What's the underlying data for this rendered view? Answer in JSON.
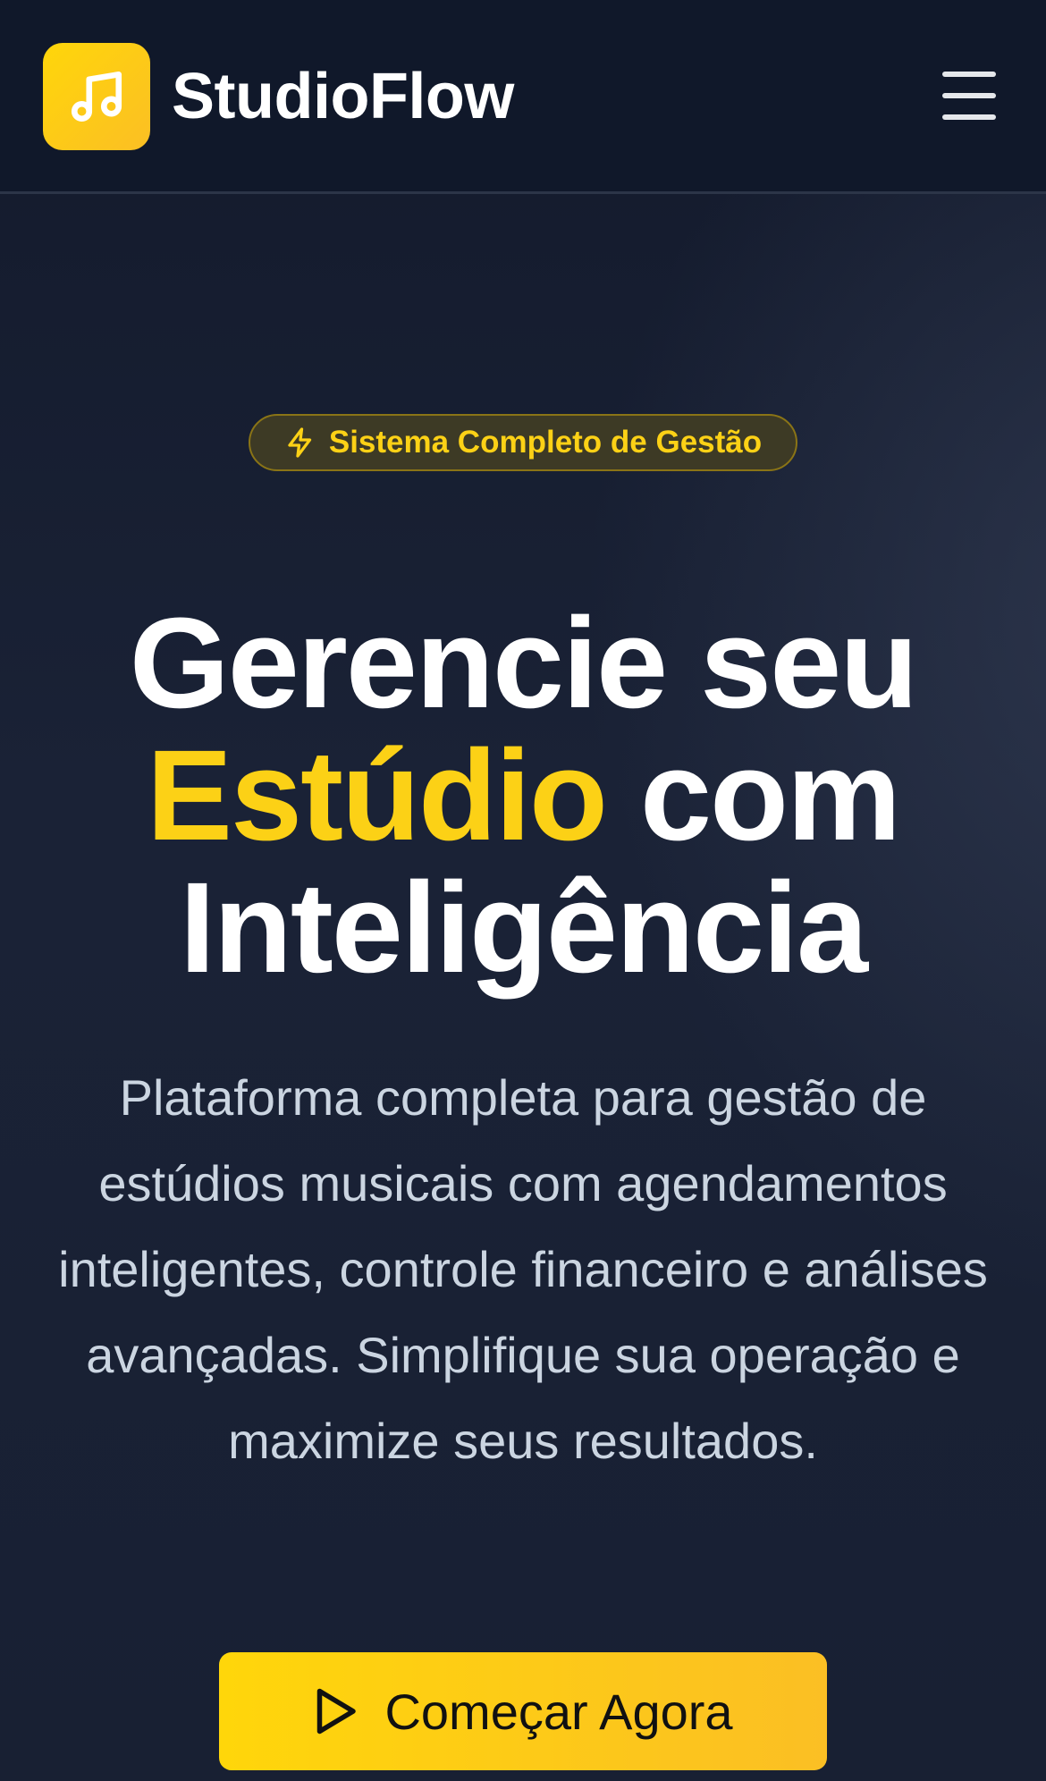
{
  "header": {
    "brand": "StudioFlow",
    "logo_icon": "music-note-icon",
    "menu_icon": "hamburger-menu-icon"
  },
  "hero": {
    "badge": {
      "icon": "lightning-icon",
      "label": "Sistema Completo de Gestão"
    },
    "headline": {
      "part1": "Gerencie seu",
      "accent": "Estúdio",
      "part2": "com",
      "part3": "Inteligência"
    },
    "description": "Plataforma completa para gestão de estúdios musicais com agendamentos inteligentes, controle financeiro e análises avançadas. Simplifique sua operação e maximize seus resultados.",
    "cta": {
      "icon": "play-icon",
      "label": "Começar Agora"
    }
  },
  "colors": {
    "accent": "#fcd116",
    "background": "#111827",
    "text": "#ffffff",
    "muted_text": "#cbd5e1"
  }
}
